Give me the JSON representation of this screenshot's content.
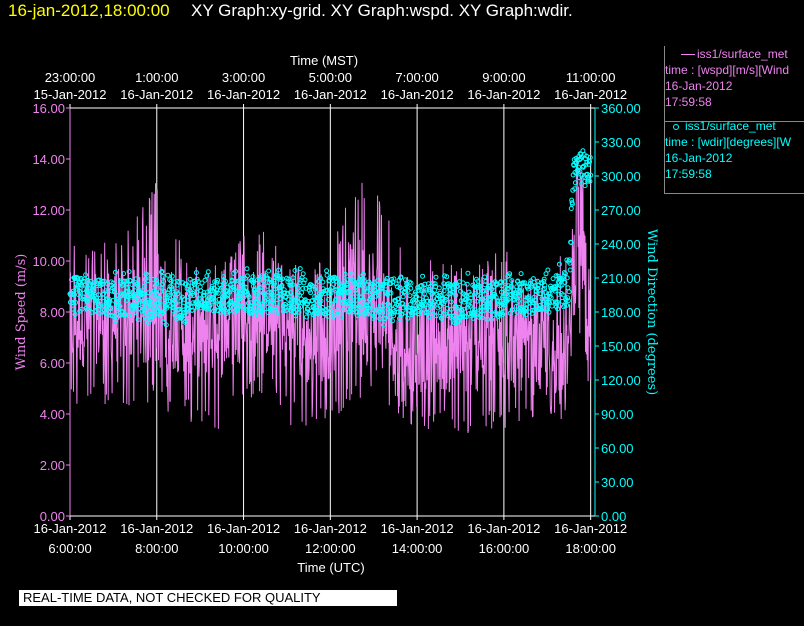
{
  "header": {
    "date": "16-jan-2012,18:00:00",
    "graphs": "XY Graph:xy-grid.  XY Graph:wspd.  XY Graph:wdir."
  },
  "legend": {
    "wspd": {
      "name": "iss1/surface_met",
      "line2": "time : [wspd][m/s][Wind",
      "date": "16-Jan-2012",
      "time": "17:59:58"
    },
    "wdir": {
      "name": "iss1/surface_met",
      "line2": "time : [wdir][degrees][W",
      "date": "16-Jan-2012",
      "time": "17:59:58"
    }
  },
  "footer": {
    "note": "REAL-TIME DATA, NOT CHECKED FOR QUALITY"
  },
  "colors": {
    "wspd": "#ee82ee",
    "wdir": "#00ffff",
    "grid": "#ffffff",
    "axis": "#ffffff",
    "header_date": "#ffff00",
    "background": "#000000"
  },
  "chart_data": {
    "type": "line",
    "x_unit": "hours",
    "xlim": [
      6.0,
      18.1
    ],
    "top_axis": {
      "title": "Time (MST)",
      "times": [
        "23:00:00",
        "1:00:00",
        "3:00:00",
        "5:00:00",
        "7:00:00",
        "9:00:00",
        "11:00:00"
      ],
      "dates": [
        "15-Jan-2012",
        "16-Jan-2012",
        "16-Jan-2012",
        "16-Jan-2012",
        "16-Jan-2012",
        "16-Jan-2012",
        "16-Jan-2012"
      ],
      "x": [
        6,
        8,
        10,
        12,
        14,
        16,
        18
      ]
    },
    "bottom_axis": {
      "title": "Time (UTC)",
      "dates": [
        "16-Jan-2012",
        "16-Jan-2012",
        "16-Jan-2012",
        "16-Jan-2012",
        "16-Jan-2012",
        "16-Jan-2012",
        "16-Jan-2012"
      ],
      "times": [
        "6:00:00",
        "8:00:00",
        "10:00:00",
        "12:00:00",
        "14:00:00",
        "16:00:00",
        "18:00:00"
      ],
      "x": [
        6,
        8,
        10,
        12,
        14,
        16,
        18
      ]
    },
    "grid": true,
    "left_axis": {
      "label": "Wind Speed (m/s)",
      "ylim": [
        0,
        16
      ],
      "ticks": [
        "0.00",
        "2.00",
        "4.00",
        "6.00",
        "8.00",
        "10.00",
        "12.00",
        "14.00",
        "16.00"
      ]
    },
    "right_axis": {
      "label": "Wind Direction (degrees)",
      "ylim": [
        0,
        360
      ],
      "ticks": [
        "0.00",
        "30.00",
        "60.00",
        "90.00",
        "120.00",
        "150.00",
        "180.00",
        "210.00",
        "240.00",
        "270.00",
        "300.00",
        "330.00",
        "360.00"
      ]
    },
    "series": [
      {
        "name": "iss1/surface_met",
        "variable": "wspd",
        "axis": "left",
        "style": "line",
        "x": [
          6.0,
          6.5,
          7.0,
          7.5,
          8.0,
          8.5,
          9.0,
          9.5,
          10.0,
          10.5,
          11.0,
          11.5,
          12.0,
          12.5,
          13.0,
          13.5,
          14.0,
          14.5,
          15.0,
          15.5,
          16.0,
          16.5,
          17.0,
          17.3,
          17.5,
          17.6,
          17.75,
          17.9,
          18.0
        ],
        "mean": [
          7.6,
          7.7,
          7.8,
          7.9,
          8.1,
          7.6,
          7.2,
          7.2,
          7.9,
          8.0,
          7.3,
          6.8,
          7.2,
          8.8,
          8.2,
          7.1,
          6.5,
          6.8,
          6.5,
          6.8,
          7.1,
          6.3,
          6.2,
          6.6,
          6.4,
          9.5,
          12.0,
          8.8,
          5.5
        ],
        "min": [
          4.0,
          4.2,
          4.3,
          4.3,
          4.4,
          3.8,
          3.3,
          3.4,
          4.5,
          4.8,
          3.6,
          3.4,
          3.6,
          4.6,
          4.2,
          4.0,
          3.3,
          3.3,
          3.0,
          3.0,
          3.3,
          3.8,
          3.5,
          3.7,
          4.0,
          5.0,
          7.0,
          5.5,
          4.3
        ],
        "max": [
          11.2,
          10.6,
          11.0,
          11.8,
          13.2,
          11.0,
          9.8,
          10.0,
          11.0,
          11.2,
          10.0,
          9.8,
          10.2,
          13.2,
          13.5,
          10.8,
          9.6,
          10.3,
          9.8,
          10.0,
          10.7,
          9.2,
          9.5,
          10.2,
          10.0,
          12.5,
          15.8,
          12.0,
          9.0
        ]
      },
      {
        "name": "iss1/surface_met",
        "variable": "wdir",
        "axis": "right",
        "style": "points",
        "x": [
          6.0,
          6.5,
          7.0,
          7.5,
          8.0,
          8.5,
          9.0,
          9.5,
          10.0,
          10.5,
          11.0,
          11.5,
          12.0,
          12.5,
          13.0,
          13.5,
          14.0,
          14.5,
          15.0,
          15.5,
          16.0,
          16.5,
          17.0,
          17.3,
          17.5,
          17.6,
          17.75,
          17.9,
          18.0
        ],
        "mean": [
          196,
          194,
          192,
          193,
          192,
          191,
          196,
          193,
          195,
          196,
          196,
          194,
          193,
          195,
          191,
          190,
          192,
          191,
          191,
          191,
          193,
          194,
          197,
          199,
          201,
          305,
          308,
          305,
          306
        ],
        "min": [
          180,
          177,
          174,
          176,
          172,
          170,
          182,
          177,
          180,
          178,
          180,
          176,
          172,
          178,
          172,
          170,
          175,
          175,
          172,
          172,
          177,
          180,
          182,
          185,
          188,
          290,
          293,
          290,
          292
        ],
        "max": [
          216,
          213,
          212,
          214,
          214,
          212,
          215,
          211,
          219,
          219,
          218,
          215,
          213,
          212,
          212,
          209,
          209,
          210,
          212,
          211,
          212,
          215,
          216,
          220,
          226,
          320,
          325,
          322,
          320
        ]
      }
    ]
  }
}
